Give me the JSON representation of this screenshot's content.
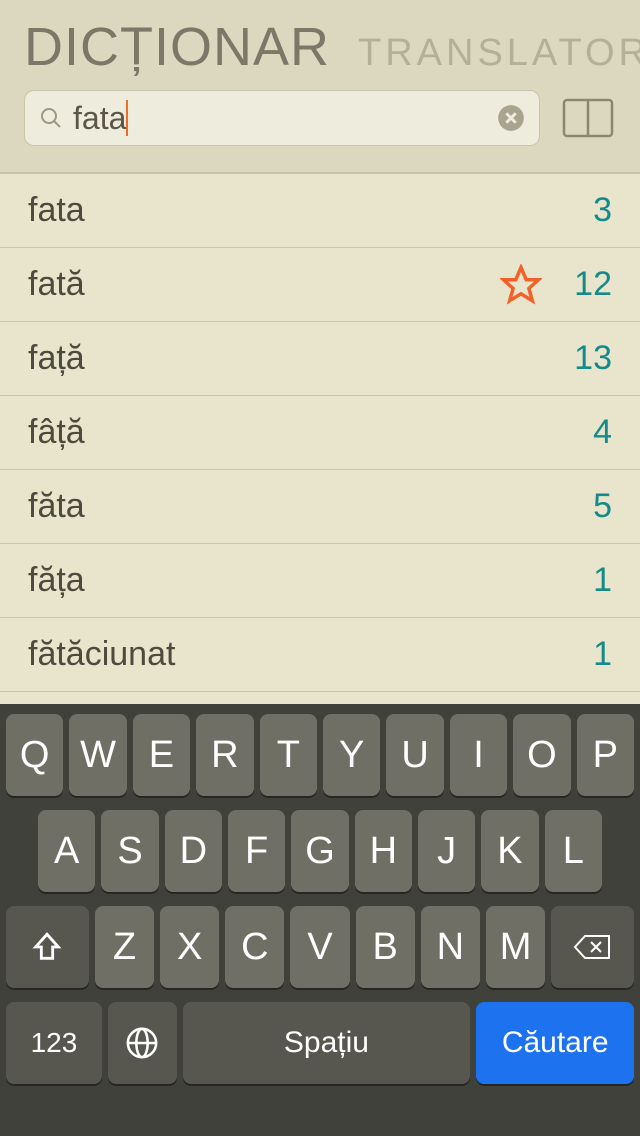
{
  "header": {
    "tab_dict": "DICȚIONAR",
    "tab_trans": "TRANSLATOR"
  },
  "search": {
    "value": "fata",
    "placeholder": ""
  },
  "results": [
    {
      "word": "fata",
      "count": "3",
      "starred": false
    },
    {
      "word": "fată",
      "count": "12",
      "starred": true
    },
    {
      "word": "față",
      "count": "13",
      "starred": false
    },
    {
      "word": "fâță",
      "count": "4",
      "starred": false
    },
    {
      "word": "făta",
      "count": "5",
      "starred": false
    },
    {
      "word": "făța",
      "count": "1",
      "starred": false
    },
    {
      "word": "fătăciunat",
      "count": "1",
      "starred": false
    }
  ],
  "keyboard": {
    "row1": [
      "Q",
      "W",
      "E",
      "R",
      "T",
      "Y",
      "U",
      "I",
      "O",
      "P"
    ],
    "row2": [
      "A",
      "S",
      "D",
      "F",
      "G",
      "H",
      "J",
      "K",
      "L"
    ],
    "row3": [
      "Z",
      "X",
      "C",
      "V",
      "B",
      "N",
      "M"
    ],
    "numbers": "123",
    "space": "Spațiu",
    "search": "Căutare"
  }
}
